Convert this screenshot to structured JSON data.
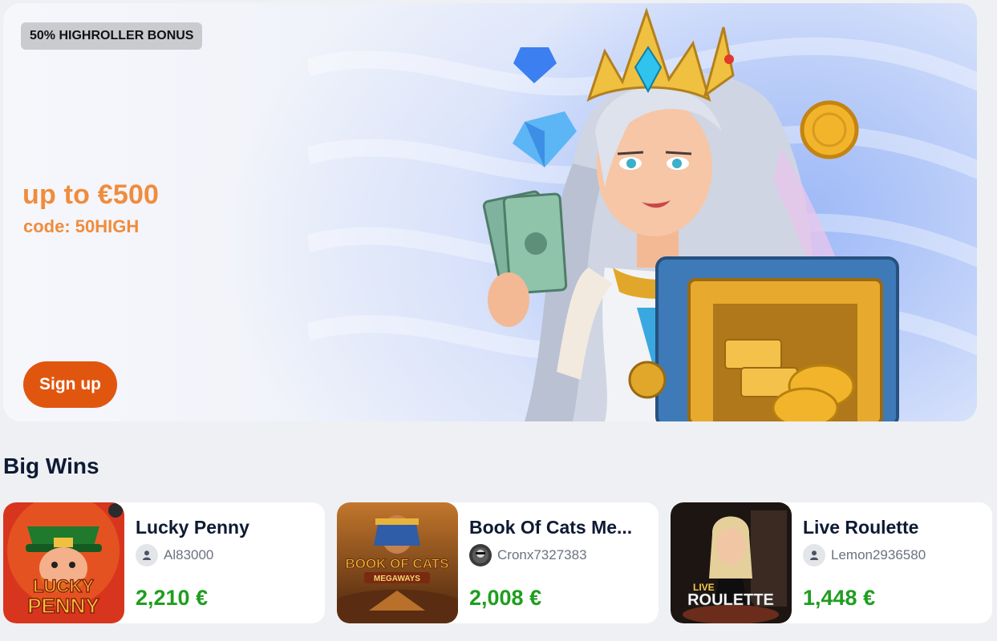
{
  "banner": {
    "badge": "50% HIGHROLLER BONUS",
    "amount": "up to €500",
    "code": "code: 50HIGH",
    "signup_label": "Sign up"
  },
  "big_wins": {
    "title": "Big Wins",
    "items": [
      {
        "game": "Lucky Penny",
        "user": "Al83000",
        "amount": "2,210 €",
        "avatar": "default-user-icon"
      },
      {
        "game": "Book Of Cats Me...",
        "user": "Cronx7327383",
        "amount": "2,008 €",
        "avatar": "custom-avatar"
      },
      {
        "game": "Live Roulette",
        "user": "Lemon2936580",
        "amount": "1,448 €",
        "avatar": "default-user-icon"
      }
    ]
  },
  "thumbnails": {
    "lucky_penny_line1": "LUCKY",
    "lucky_penny_line2": "PENNY",
    "book_of_cats_line1": "BOOK OF CATS",
    "book_of_cats_line2": "MEGAWAYS",
    "live_roulette_line1": "LIVE",
    "live_roulette_line2": "ROULETTE"
  },
  "colors": {
    "accent_orange": "#f08c3c",
    "signup_button": "#e1560f",
    "win_green": "#1e9e1e",
    "title_navy": "#0e1a33"
  }
}
